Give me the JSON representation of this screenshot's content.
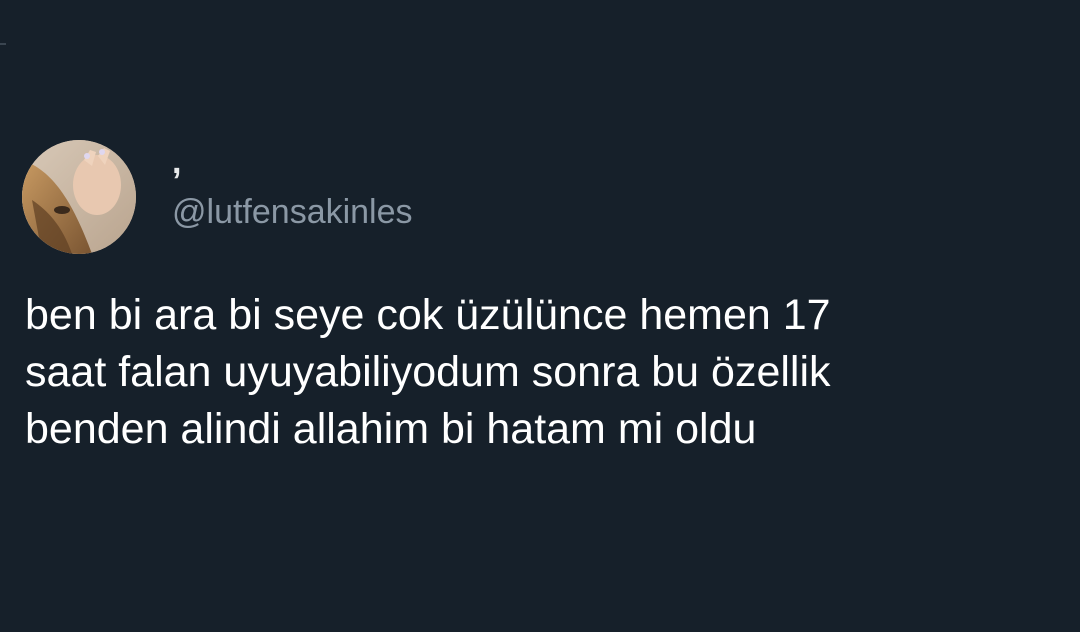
{
  "tweet": {
    "author": {
      "display_name": ",",
      "handle": "@lutfensakinles"
    },
    "text_lines": [
      "ben bi ara bi seye cok üzülünce hemen 17",
      "saat falan   uyuyabiliyodum sonra bu özellik",
      "benden alindi allahim bi hatam mi oldu"
    ]
  },
  "colors": {
    "background": "#16202a",
    "text": "#ffffff",
    "handle": "#8b98a5"
  }
}
